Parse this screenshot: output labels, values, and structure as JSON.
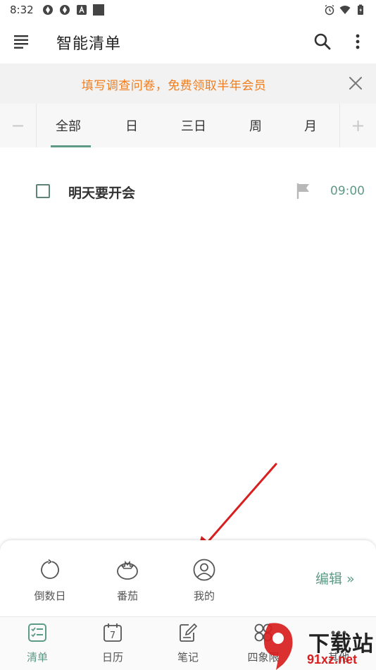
{
  "status_bar": {
    "time": "8:32"
  },
  "app_bar": {
    "title": "智能清单"
  },
  "banner": {
    "text": "填写调查问卷，免费领取半年会员"
  },
  "tabs": {
    "minus": "−",
    "plus": "+",
    "items": [
      {
        "label": "全部",
        "active": true
      },
      {
        "label": "日",
        "active": false
      },
      {
        "label": "三日",
        "active": false
      },
      {
        "label": "周",
        "active": false
      },
      {
        "label": "月",
        "active": false
      }
    ]
  },
  "task": {
    "title": "明天要开会",
    "time": "09:00"
  },
  "popup": {
    "items": [
      {
        "label": "倒数日",
        "icon": "countdown-icon"
      },
      {
        "label": "番茄",
        "icon": "tomato-icon"
      },
      {
        "label": "我的",
        "icon": "profile-icon"
      }
    ],
    "edit_label": "编辑 »"
  },
  "bottom_nav": {
    "items": [
      {
        "label": "清单",
        "icon": "checklist-icon",
        "active": true
      },
      {
        "label": "日历",
        "icon": "calendar-icon",
        "active": false,
        "calendar_day": "7"
      },
      {
        "label": "笔记",
        "icon": "note-icon",
        "active": false
      },
      {
        "label": "四象限",
        "icon": "quadrant-icon",
        "active": false
      },
      {
        "label": "其他",
        "icon": "other-icon",
        "active": false
      }
    ]
  },
  "watermark": {
    "top": "下载站",
    "bottom": "91xz.net"
  },
  "colors": {
    "accent": "#5e9b86",
    "banner_text": "#f07d1f",
    "arrow": "#d81e1e"
  }
}
